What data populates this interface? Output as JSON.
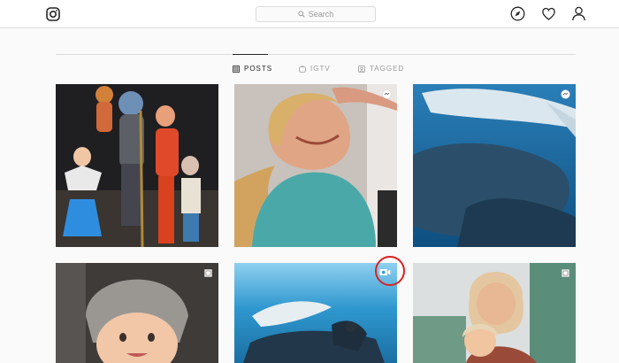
{
  "header": {
    "logo_icon": "instagram-logo-icon",
    "search": {
      "placeholder": "Search",
      "icon": "search-icon"
    },
    "nav_icons": [
      "explore-compass-icon",
      "activity-heart-icon",
      "profile-person-icon"
    ]
  },
  "profile_tabs": [
    {
      "label": "POSTS",
      "icon": "grid-icon",
      "active": true
    },
    {
      "label": "IGTV",
      "icon": "igtv-icon",
      "active": false
    },
    {
      "label": "TAGGED",
      "icon": "tagged-icon",
      "active": false
    }
  ],
  "posts": [
    {
      "subject": "family in costumes",
      "badge": null
    },
    {
      "subject": "woman in wetsuit laughing",
      "badge": "carousel-icon"
    },
    {
      "subject": "humpback whales underwater",
      "badge": "carousel-icon"
    },
    {
      "subject": "baby in knit hat",
      "badge": "multiple-photos-icon"
    },
    {
      "subject": "whale and swimmer underwater",
      "badge": "video-camera-icon",
      "highlighted": true
    },
    {
      "subject": "woman holding child",
      "badge": "multiple-photos-icon"
    }
  ],
  "colors": {
    "border": "#dbdbdb",
    "text": "#262626",
    "muted": "#999999",
    "highlight": "#d9221f"
  }
}
